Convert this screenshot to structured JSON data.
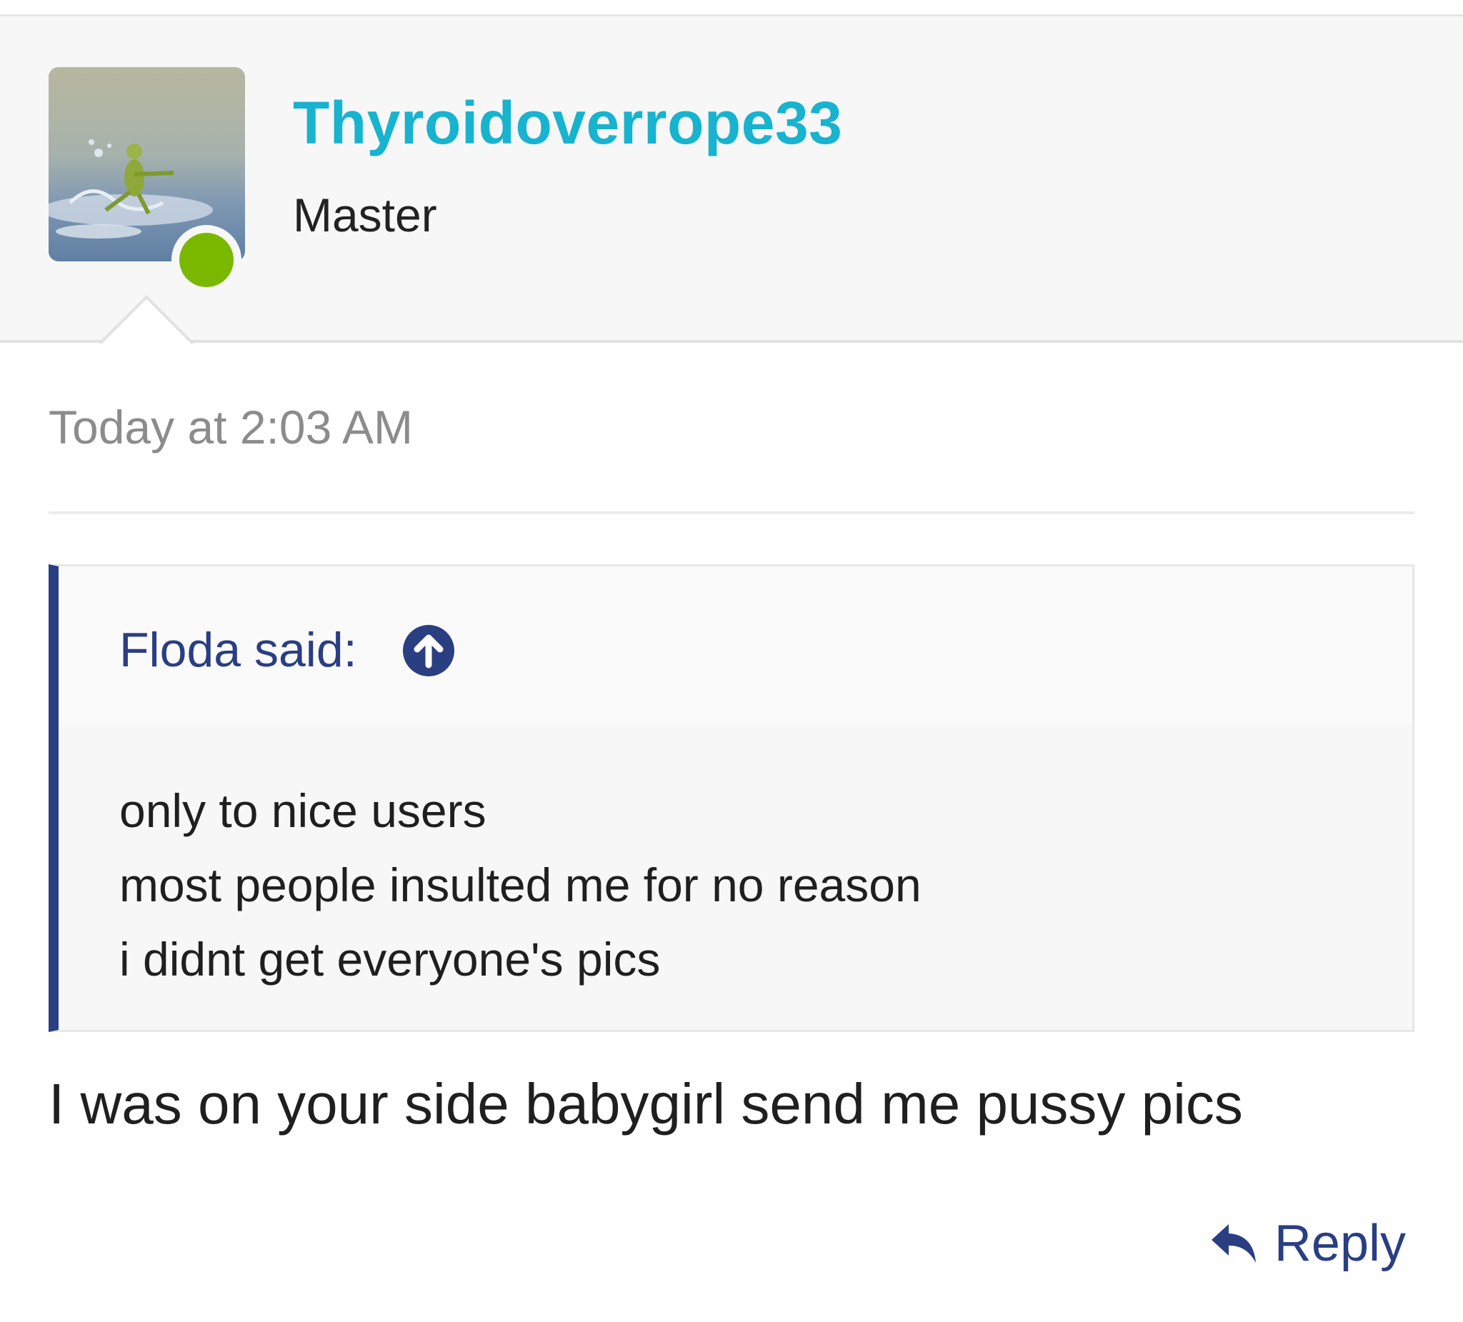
{
  "post": {
    "username": "Thyroidoverrope33",
    "user_title": "Master",
    "timestamp": "Today at 2:03 AM",
    "message": "I was on your side babygirl send me pussy pics",
    "reply_label": "Reply"
  },
  "quote": {
    "author_line": "Floda said:",
    "lines": [
      "only to nice users",
      "most people insulted me for no reason",
      "i didnt get everyone's pics"
    ]
  },
  "colors": {
    "username": "#17b3cf",
    "quote_accent": "#2a3e82",
    "online_status": "#7ab800",
    "header_bg": "#f7f7f7"
  },
  "icons": {
    "quote_jump": "arrow-up-circle-icon",
    "reply": "reply-arrow-icon",
    "online": "online-status-dot"
  }
}
